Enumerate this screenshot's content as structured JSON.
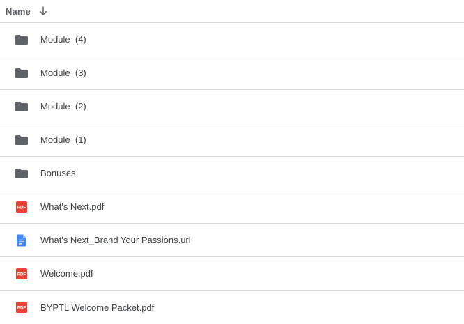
{
  "header": {
    "name_label": "Name",
    "sort_icon": "arrow-down-icon"
  },
  "files": [
    {
      "name": "Module  (4)",
      "type": "folder",
      "icon": "folder-icon"
    },
    {
      "name": "Module  (3)",
      "type": "folder",
      "icon": "folder-icon"
    },
    {
      "name": "Module  (2)",
      "type": "folder",
      "icon": "folder-icon"
    },
    {
      "name": "Module  (1)",
      "type": "folder",
      "icon": "folder-icon"
    },
    {
      "name": "Bonuses",
      "type": "folder",
      "icon": "folder-icon"
    },
    {
      "name": "What's Next.pdf",
      "type": "pdf",
      "icon": "pdf-icon"
    },
    {
      "name": "What's Next_Brand Your Passions.url",
      "type": "doc",
      "icon": "document-icon"
    },
    {
      "name": "Welcome.pdf",
      "type": "pdf",
      "icon": "pdf-icon"
    },
    {
      "name": "BYPTL Welcome Packet.pdf",
      "type": "pdf",
      "icon": "pdf-icon"
    }
  ],
  "colors": {
    "folder": "#5f6368",
    "pdf": "#ea4335",
    "doc": "#4285f4",
    "divider": "#dadce0",
    "text": "#3c4043"
  }
}
